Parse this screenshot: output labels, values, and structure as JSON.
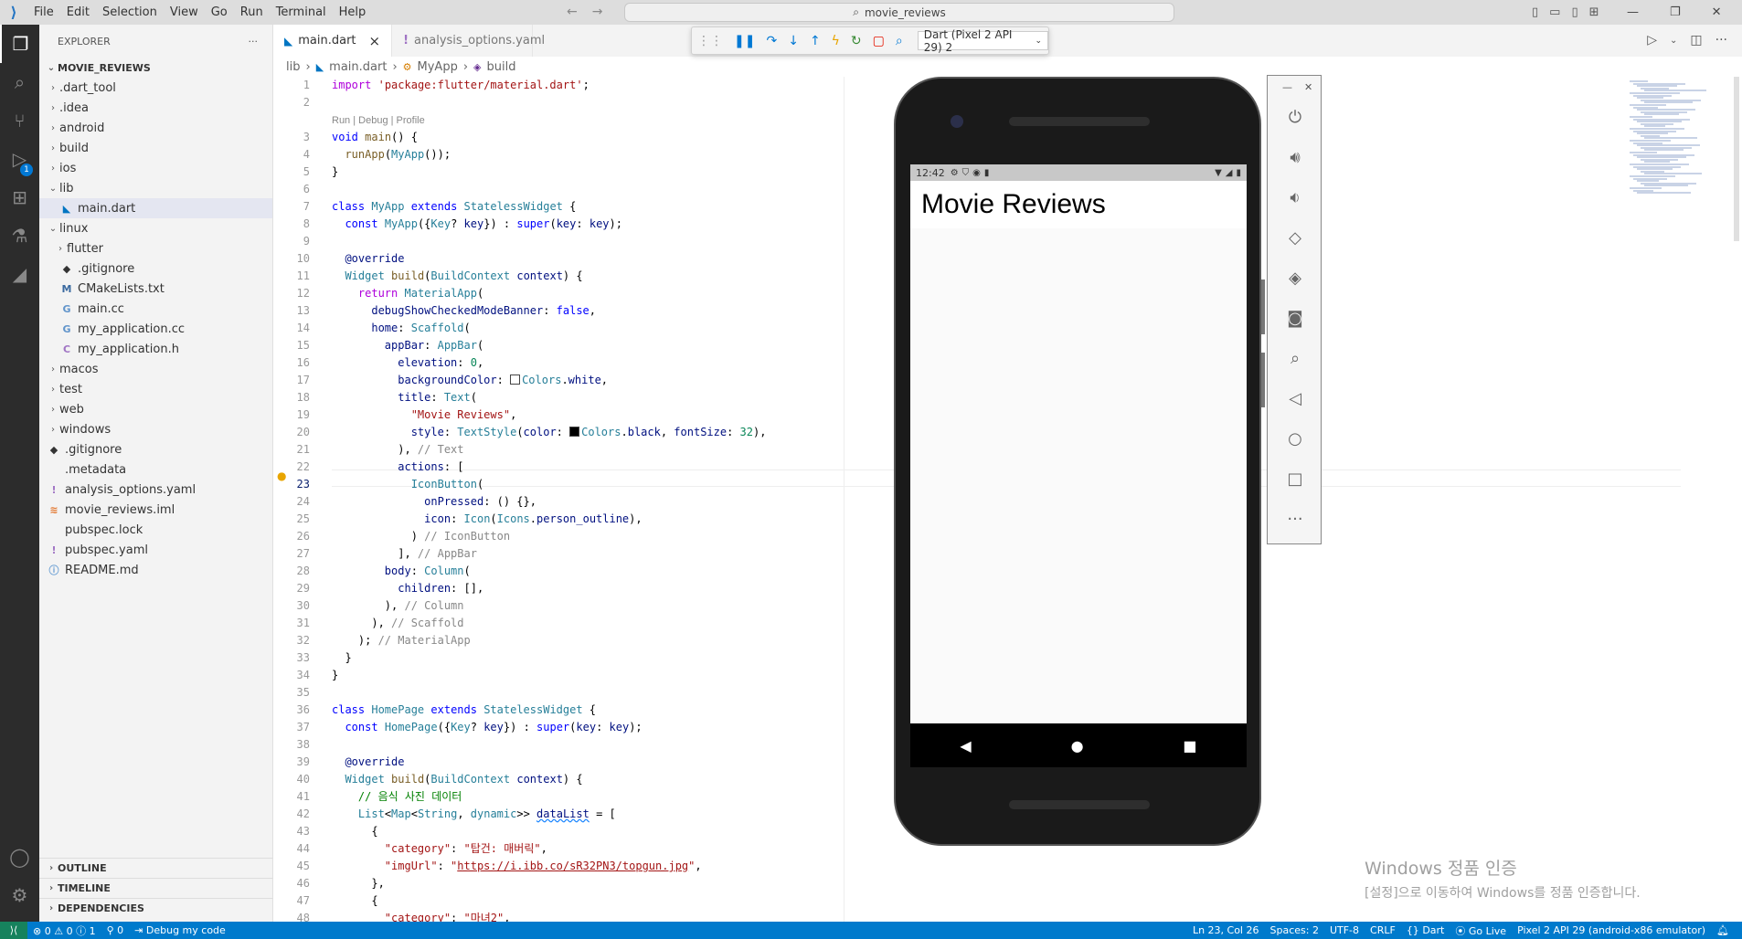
{
  "titlebar": {
    "menu": [
      "File",
      "Edit",
      "Selection",
      "View",
      "Go",
      "Run",
      "Terminal",
      "Help"
    ],
    "search": "movie_reviews"
  },
  "activity": {
    "run_badge": "1"
  },
  "explorer": {
    "header": "EXPLORER",
    "more": "···",
    "root": "MOVIE_REVIEWS",
    "items": [
      {
        "label": ".dart_tool",
        "type": "folder",
        "depth": 0,
        "expanded": false
      },
      {
        "label": ".idea",
        "type": "folder",
        "depth": 0,
        "expanded": false
      },
      {
        "label": "android",
        "type": "folder",
        "depth": 0,
        "expanded": false
      },
      {
        "label": "build",
        "type": "folder",
        "depth": 0,
        "expanded": false
      },
      {
        "label": "ios",
        "type": "folder",
        "depth": 0,
        "expanded": false
      },
      {
        "label": "lib",
        "type": "folder",
        "depth": 0,
        "expanded": true
      },
      {
        "label": "main.dart",
        "type": "dart",
        "depth": 1,
        "selected": true
      },
      {
        "label": "linux",
        "type": "folder",
        "depth": 0,
        "expanded": true
      },
      {
        "label": "flutter",
        "type": "folder",
        "depth": 1,
        "expanded": false
      },
      {
        "label": ".gitignore",
        "type": "git",
        "depth": 1
      },
      {
        "label": "CMakeLists.txt",
        "type": "cmake",
        "depth": 1
      },
      {
        "label": "main.cc",
        "type": "cpp",
        "depth": 1
      },
      {
        "label": "my_application.cc",
        "type": "cpp",
        "depth": 1
      },
      {
        "label": "my_application.h",
        "type": "h",
        "depth": 1
      },
      {
        "label": "macos",
        "type": "folder",
        "depth": 0,
        "expanded": false
      },
      {
        "label": "test",
        "type": "folder",
        "depth": 0,
        "expanded": false
      },
      {
        "label": "web",
        "type": "folder",
        "depth": 0,
        "expanded": false
      },
      {
        "label": "windows",
        "type": "folder",
        "depth": 0,
        "expanded": false
      },
      {
        "label": ".gitignore",
        "type": "git",
        "depth": 0
      },
      {
        "label": ".metadata",
        "type": "meta",
        "depth": 0
      },
      {
        "label": "analysis_options.yaml",
        "type": "yaml",
        "depth": 0
      },
      {
        "label": "movie_reviews.iml",
        "type": "iml",
        "depth": 0
      },
      {
        "label": "pubspec.lock",
        "type": "lock",
        "depth": 0
      },
      {
        "label": "pubspec.yaml",
        "type": "yaml",
        "depth": 0
      },
      {
        "label": "README.md",
        "type": "info",
        "depth": 0
      }
    ],
    "sections": [
      "OUTLINE",
      "TIMELINE",
      "DEPENDENCIES"
    ]
  },
  "tabs": [
    {
      "label": "main.dart",
      "active": true,
      "close": "×"
    },
    {
      "label": "analysis_options.yaml",
      "active": false,
      "marker": "!"
    }
  ],
  "debug": {
    "device": "Dart (Pixel 2 API 29) 2"
  },
  "breadcrumb": {
    "parts": [
      "lib",
      "main.dart",
      "MyApp",
      "build"
    ]
  },
  "editor": {
    "current_line": 23,
    "codelens": "Run | Debug | Profile"
  },
  "emulator": {
    "time": "12:42",
    "app_title": "Movie Reviews"
  },
  "watermark": {
    "line1": "Windows 정품 인증",
    "line2": "[설정]으로 이동하여 Windows를 정품 인증합니다."
  },
  "status": {
    "errors": "0",
    "warnings": "0",
    "infos": "1",
    "ports": "0",
    "debug": "Debug my code",
    "position": "Ln 23, Col 26",
    "spaces": "Spaces: 2",
    "encoding": "UTF-8",
    "eol": "CRLF",
    "language": "Dart",
    "golive": "Go Live",
    "device": "Pixel 2 API 29 (android-x86 emulator)"
  },
  "colors": {
    "accent": "#007acc",
    "activity_bg": "#2c2c2c",
    "sidebar_bg": "#f3f3f3"
  }
}
